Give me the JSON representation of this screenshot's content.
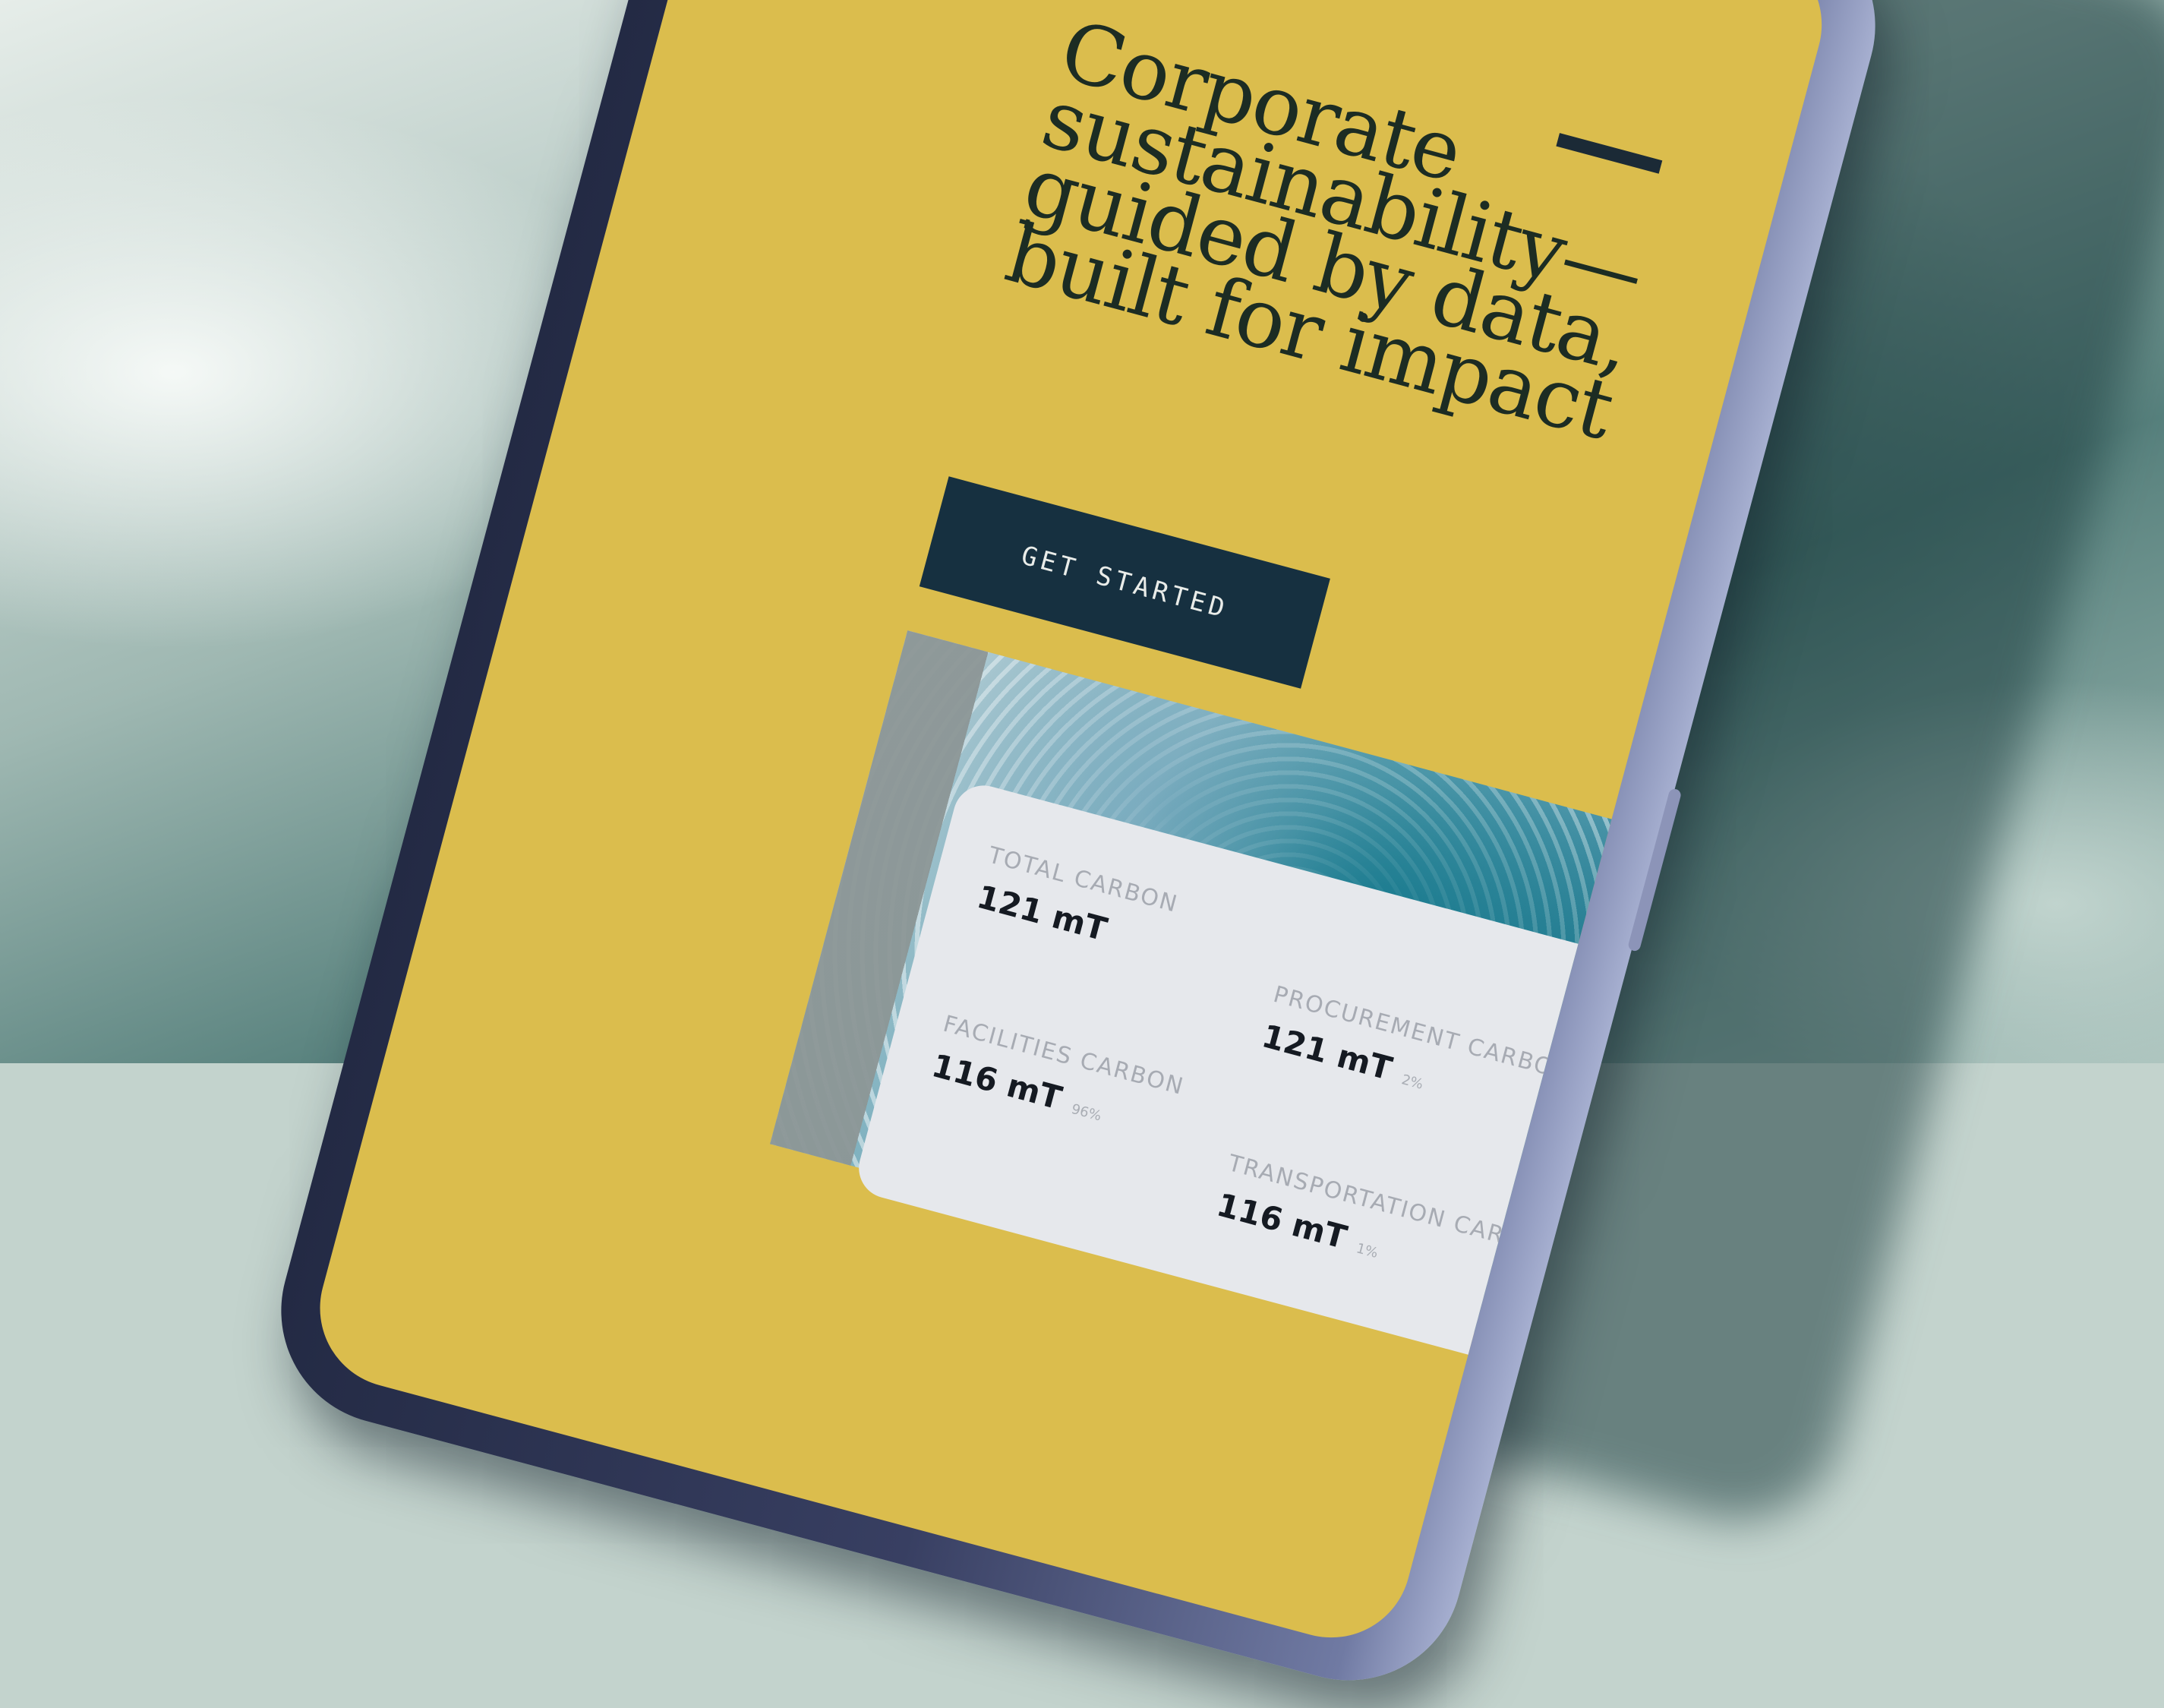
{
  "hero": {
    "headline_lines": [
      "Corporate",
      "sustainability—",
      "guided by data,",
      "built for impact"
    ],
    "cta_label": "GET STARTED"
  },
  "stats": [
    {
      "label": "TOTAL CARBON",
      "value": "121 mT",
      "percent": ""
    },
    {
      "label": "PROCUREMENT CARBON",
      "value": "121 mT",
      "percent": "2%"
    },
    {
      "label": "FACILITIES CARBON",
      "value": "116 mT",
      "percent": "96%"
    },
    {
      "label": "TRANSPORTATION CARBON",
      "value": "116 mT",
      "percent": "1%"
    }
  ],
  "colors": {
    "screen_background": "#dbbd4d",
    "headline_text": "#1c2c23",
    "cta_background": "#163040",
    "card_background": "#e6e8ec",
    "phone_frame": "#383f62"
  }
}
